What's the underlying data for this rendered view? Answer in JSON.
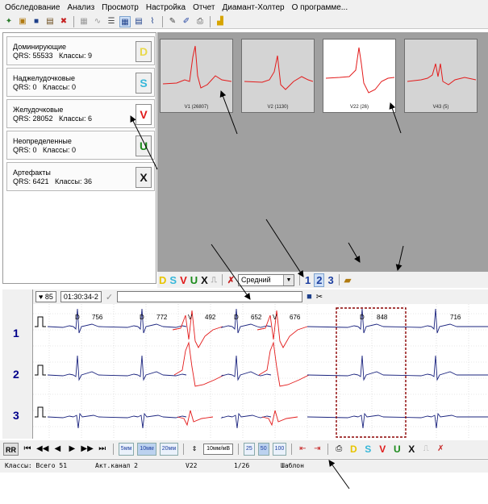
{
  "menu": [
    "Обследование",
    "Анализ",
    "Просмотр",
    "Настройка",
    "Отчет",
    "Диамант-Холтер",
    "О программе..."
  ],
  "classes": [
    {
      "name": "Доминирующие",
      "qrs": "QRS: 55533",
      "count": "Классы: 9",
      "button": "D",
      "color": "#e8d84a"
    },
    {
      "name": "Наджелудочковые",
      "qrs": "QRS: 0",
      "count": "Классы: 0",
      "button": "S",
      "color": "#37b7d9"
    },
    {
      "name": "Желудочковые",
      "qrs": "QRS: 28052",
      "count": "Классы: 6",
      "button": "V",
      "color": "#e01919"
    },
    {
      "name": "Неопределенные",
      "qrs": "QRS: 0",
      "count": "Классы: 0",
      "button": "U",
      "color": "#1a8a1a"
    },
    {
      "name": "Артефакты",
      "qrs": "QRS: 6421",
      "count": "Классы: 36",
      "button": "X",
      "color": "#111111"
    }
  ],
  "templates": [
    {
      "label": "V1 (26807)"
    },
    {
      "label": "V2 (1130)"
    },
    {
      "label": "V22 (26)"
    },
    {
      "label": "V43 (5)"
    }
  ],
  "template_bar": {
    "d": "D",
    "s": "S",
    "v": "V",
    "u": "U",
    "x": "X",
    "mode": "Средний",
    "n1": "1",
    "n2": "2",
    "n3": "3"
  },
  "ecg_header": {
    "hr": "85",
    "time": "01:30:34-2"
  },
  "leads": [
    "1",
    "2",
    "3"
  ],
  "beats": [
    {
      "rr": "756",
      "type": "D"
    },
    {
      "rr": "772",
      "type": "D"
    },
    {
      "rr": "492",
      "type": "V"
    },
    {
      "rr": "652",
      "type": "D"
    },
    {
      "rr": "676",
      "type": "V"
    },
    {
      "rr": "848",
      "type": "D"
    },
    {
      "rr": "716",
      "type": ""
    }
  ],
  "bottom": {
    "rr": "RR",
    "speed5": "5",
    "speed10": "10",
    "speed20": "20",
    "speed_unit": "мм",
    "gain": "10мм/мВ",
    "z25": "25",
    "z50": "50",
    "z100": "100",
    "d": "D",
    "s": "S",
    "v": "V",
    "u": "U",
    "x": "X"
  },
  "status": {
    "classes": "Классы: Всего 51",
    "channel": "Акт.канал 2",
    "cls": "V22",
    "pos": "1/26",
    "mode": "Шаблон"
  },
  "colors": {
    "ecg_normal": "#1a237e",
    "ecg_ventricular": "#e31b1b",
    "selection": "#8b0000"
  }
}
